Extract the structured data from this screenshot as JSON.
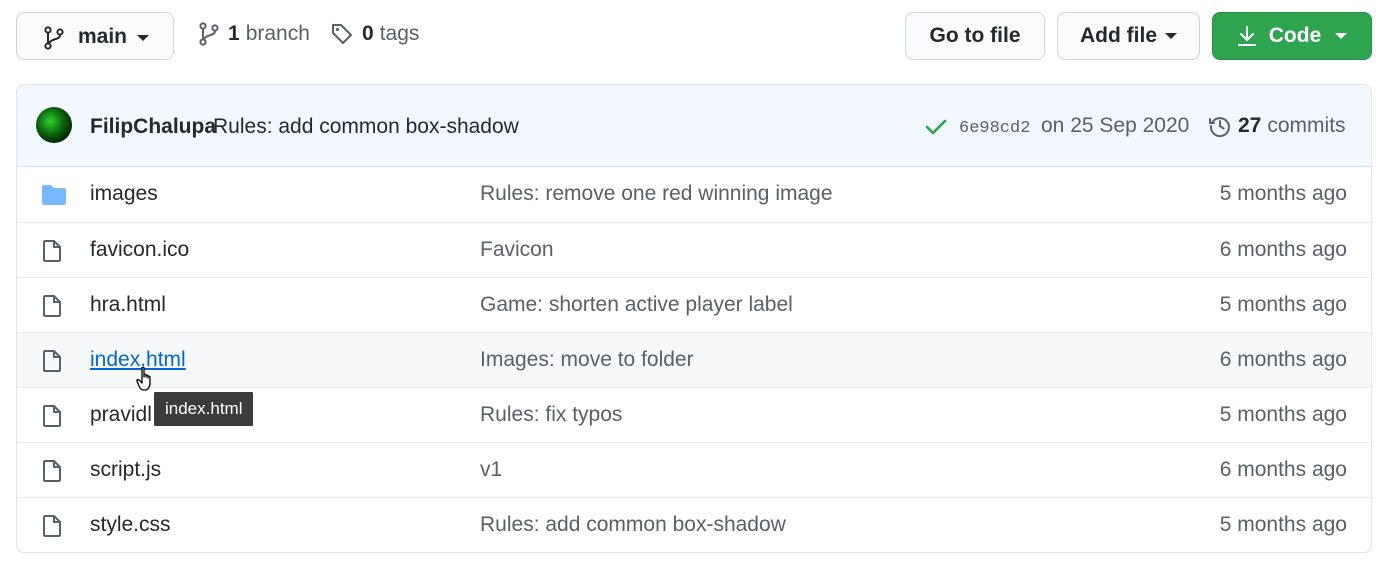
{
  "toolbar": {
    "branch_name": "main",
    "branch_count": "1",
    "branch_label": "branch",
    "tag_count": "0",
    "tag_label": "tags",
    "goto_file": "Go to file",
    "add_file": "Add file",
    "code": "Code",
    "code_color": "#2ea44f"
  },
  "commit": {
    "author": "FilipChalupa",
    "message": "Rules: add common box-shadow",
    "sha": "6e98cd2",
    "date": "on 25 Sep 2020",
    "commit_count": "27",
    "commits_label": "commits"
  },
  "files": [
    {
      "name": "images",
      "message": "Rules: remove one red winning image",
      "age": "5 months ago",
      "icon": "folder-icon"
    },
    {
      "name": "favicon.ico",
      "message": "Favicon",
      "age": "6 months ago",
      "icon": "file-icon"
    },
    {
      "name": "hra.html",
      "message": "Game: shorten active player label",
      "age": "5 months ago",
      "icon": "file-icon"
    },
    {
      "name": "index.html",
      "message": "Images: move to folder",
      "age": "6 months ago",
      "icon": "file-icon",
      "hovered": true
    },
    {
      "name": "pravidl",
      "message": "Rules: fix typos",
      "age": "5 months ago",
      "icon": "file-icon"
    },
    {
      "name": "script.js",
      "message": "v1",
      "age": "6 months ago",
      "icon": "file-icon"
    },
    {
      "name": "style.css",
      "message": "Rules: add common box-shadow",
      "age": "5 months ago",
      "icon": "file-icon"
    }
  ],
  "tooltip": {
    "text": "index.html"
  }
}
